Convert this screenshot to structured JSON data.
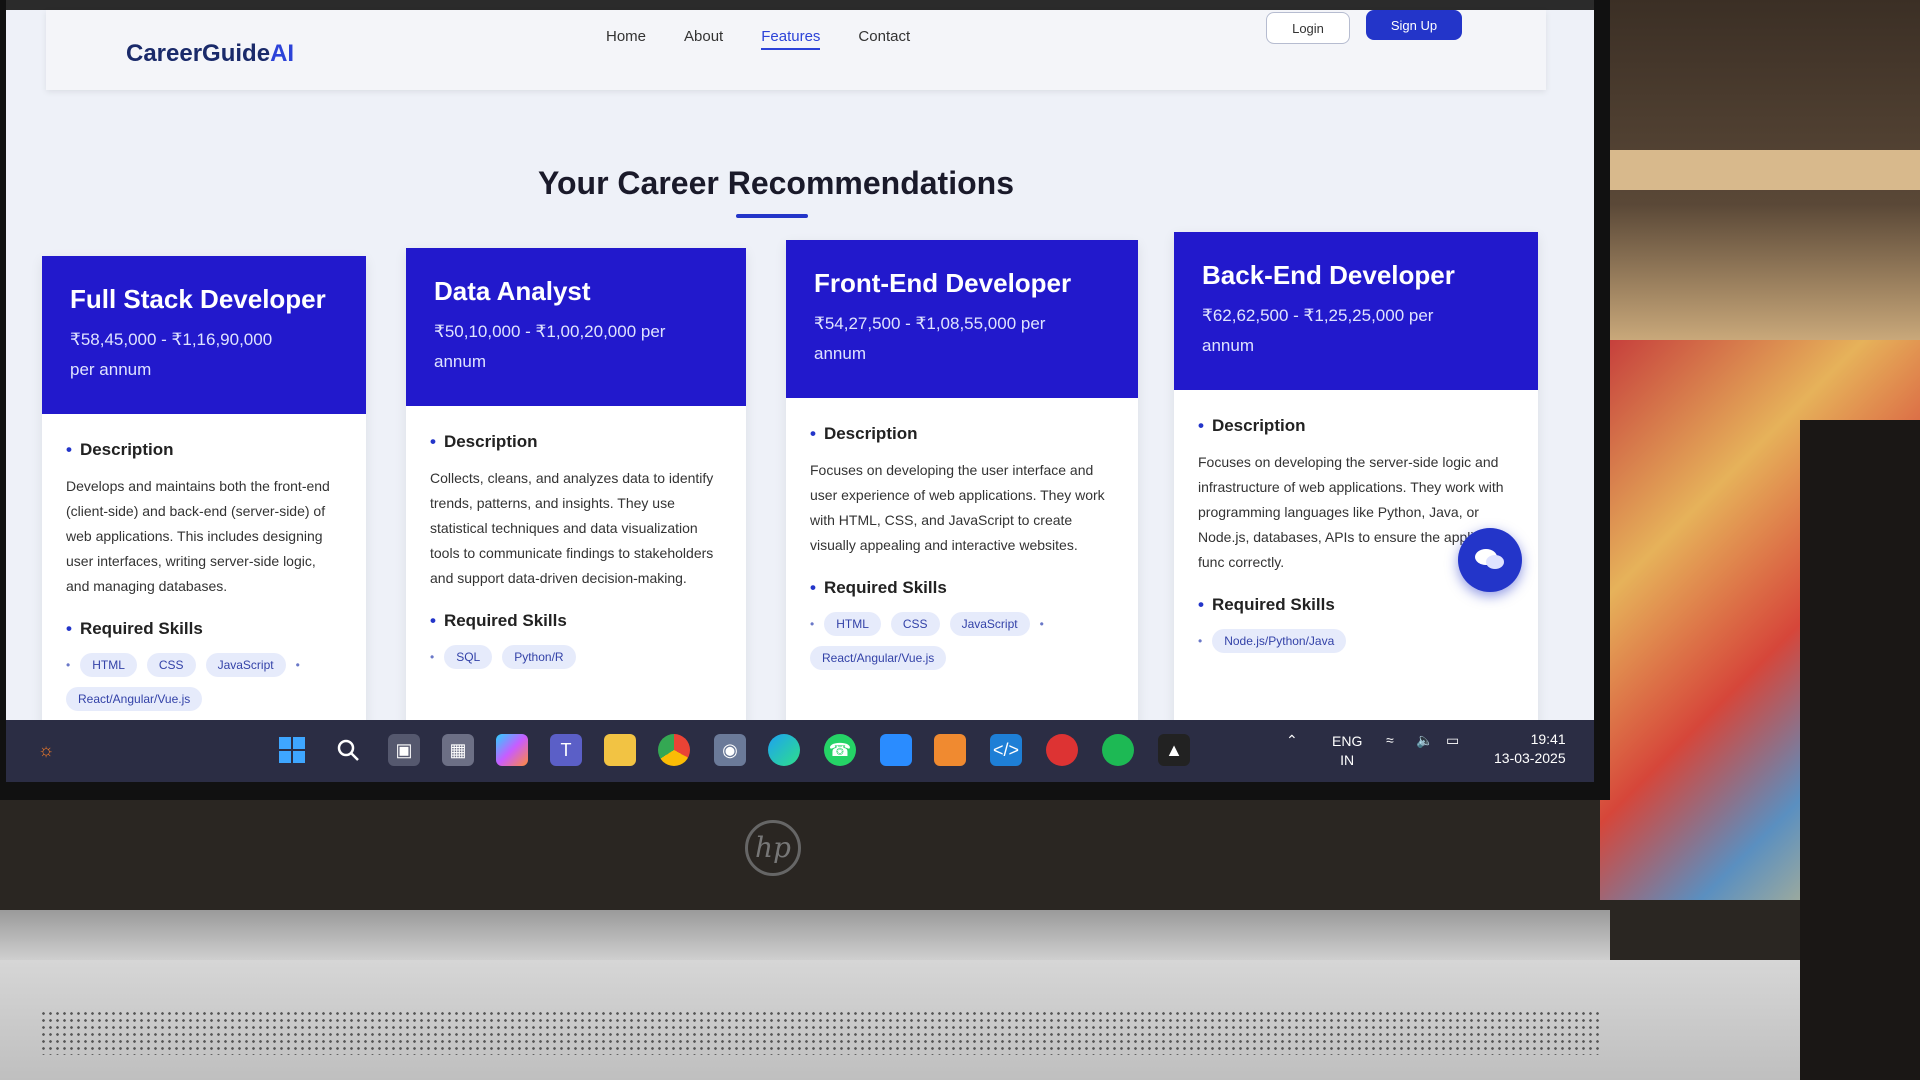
{
  "app": {
    "brand": "CareerGuide",
    "brand_accent": "AI"
  },
  "nav": {
    "links": [
      "Home",
      "About",
      "Features",
      "Contact"
    ],
    "active": "Features",
    "login": "Login",
    "signup": "Sign Up"
  },
  "section_title": "Your Career Recommendations",
  "cards": [
    {
      "title": "Full Stack Developer",
      "salary": "₹58,45,000 - ₹1,16,90,000 per annum",
      "description_label": "Description",
      "description": "Develops and maintains both the front-end (client-side) and back-end (server-side) of web applications. This includes designing user interfaces, writing server-side logic, and managing databases.",
      "skills_label": "Required Skills",
      "skills": [
        "HTML",
        "CSS",
        "JavaScript",
        "React/Angular/Vue.js"
      ]
    },
    {
      "title": "Data Analyst",
      "salary": "₹50,10,000 - ₹1,00,20,000 per annum",
      "description_label": "Description",
      "description": "Collects, cleans, and analyzes data to identify trends, patterns, and insights. They use statistical techniques and data visualization tools to communicate findings to stakeholders and support data-driven decision-making.",
      "skills_label": "Required Skills",
      "skills": [
        "SQL",
        "Python/R"
      ]
    },
    {
      "title": "Front-End Developer",
      "salary": "₹54,27,500 - ₹1,08,55,000 per annum",
      "description_label": "Description",
      "description": "Focuses on developing the user interface and user experience of web applications. They work with HTML, CSS, and JavaScript to create visually appealing and interactive websites.",
      "skills_label": "Required Skills",
      "skills": [
        "HTML",
        "CSS",
        "JavaScript",
        "React/Angular/Vue.js"
      ]
    },
    {
      "title": "Back-End Developer",
      "salary": "₹62,62,500 - ₹1,25,25,000 per annum",
      "description_label": "Description",
      "description": "Focuses on developing the server-side logic and infrastructure of web applications. They work with programming languages like Python, Java, or Node.js, databases, APIs to ensure the application func correctly.",
      "skills_label": "Required Skills",
      "skills": [
        "Node.js/Python/Java"
      ]
    }
  ],
  "taskbar": {
    "icons": [
      "start-icon",
      "search-icon",
      "task-view-icon",
      "calculator-icon",
      "copilot-icon",
      "teams-icon",
      "file-explorer-icon",
      "chrome-icon",
      "camera-icon",
      "edge-icon",
      "whatsapp-icon",
      "hp-app-icon",
      "office-icon",
      "vscode-icon",
      "game-icon",
      "spotify-icon",
      "media-icon"
    ],
    "language": "ENG",
    "region": "IN",
    "time": "19:41",
    "date": "13-03-2025"
  },
  "colors": {
    "brand": "#2335c9",
    "card_head": "#2219cc",
    "taskbar": "#2b2d44"
  }
}
